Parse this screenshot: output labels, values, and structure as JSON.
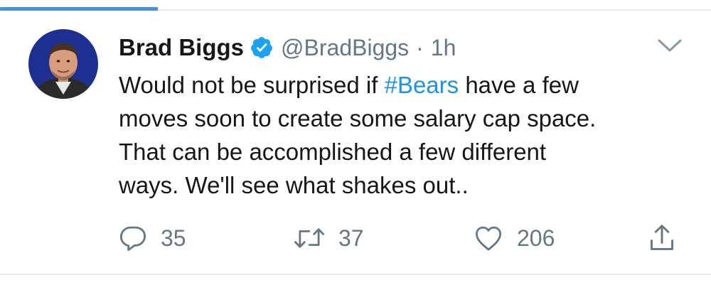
{
  "tweet": {
    "author": {
      "name": "Brad Biggs",
      "handle": "@BradBiggs",
      "verified": true
    },
    "separator": "·",
    "time": "1h",
    "text": {
      "before_hashtag": "Would not be surprised if ",
      "hashtag": "#Bears",
      "after_hashtag": " have a few",
      "line2": "moves soon to create some salary cap space.",
      "line3": "That can be accomplished a few different",
      "line4": "ways. We'll see what shakes out.."
    },
    "actions": {
      "replies": "35",
      "retweets": "37",
      "likes": "206"
    }
  },
  "icons": {
    "verified": "verified-badge-icon",
    "caret": "chevron-down-icon",
    "reply": "reply-icon",
    "retweet": "retweet-icon",
    "like": "heart-icon",
    "share": "share-icon"
  },
  "colors": {
    "accent": "#1b95e0",
    "tab_indicator": "#4a90d9",
    "text": "#14171a",
    "secondary": "#657786",
    "border": "#e6ecf0"
  }
}
